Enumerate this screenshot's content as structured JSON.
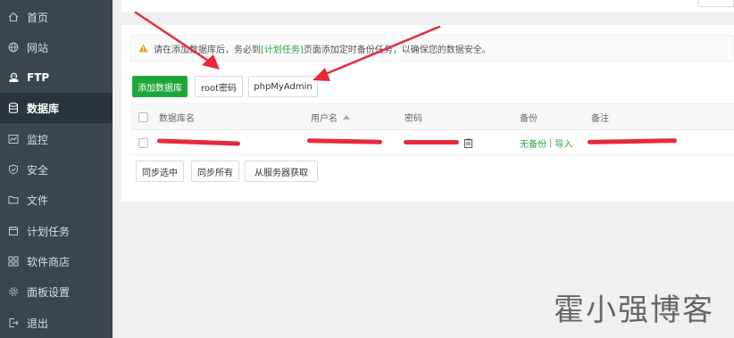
{
  "sidebar": {
    "items": [
      {
        "label": "首页",
        "icon": "home-icon"
      },
      {
        "label": "网站",
        "icon": "globe-icon"
      },
      {
        "label": "FTP",
        "icon": "ftp-icon"
      },
      {
        "label": "数据库",
        "icon": "database-icon"
      },
      {
        "label": "监控",
        "icon": "monitor-icon"
      },
      {
        "label": "安全",
        "icon": "shield-icon"
      },
      {
        "label": "文件",
        "icon": "folder-icon"
      },
      {
        "label": "计划任务",
        "icon": "calendar-icon"
      },
      {
        "label": "软件商店",
        "icon": "apps-icon"
      },
      {
        "label": "面板设置",
        "icon": "gear-icon"
      },
      {
        "label": "退出",
        "icon": "logout-icon"
      }
    ],
    "active": "数据库"
  },
  "warning": {
    "prefix": "请在添加数据库后，务必到",
    "link": "[计划任务]",
    "suffix": "页面添加定时备份任务，以确保您的数据安全。"
  },
  "toolbar": {
    "add_db": "添加数据库",
    "root_pw": "root密码",
    "phpmyadmin": "phpMyAdmin"
  },
  "table": {
    "headers": {
      "name": "数据库名",
      "user": "用户名",
      "password": "密码",
      "backup": "备份",
      "note": "备注"
    },
    "row": {
      "backup_status": "无备份",
      "separator": "|",
      "import": "导入"
    }
  },
  "actions": {
    "sync_selected": "同步选中",
    "sync_all": "同步所有",
    "fetch_from_server": "从服务器获取"
  },
  "watermark": "霍小强博客",
  "colors": {
    "sidebar_bg": "#3c444d",
    "sidebar_active": "#2c333a",
    "accent_green": "#20a53a",
    "annotation_red": "#e8293a"
  }
}
